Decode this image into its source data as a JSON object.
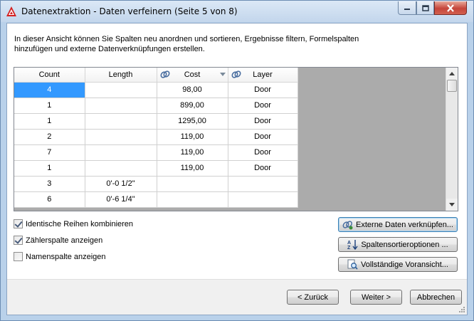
{
  "window": {
    "title": "Datenextraktion - Daten verfeinern (Seite 5 von 8)"
  },
  "description": "In dieser Ansicht können Sie Spalten neu anordnen und sortieren, Ergebnisse filtern, Formelspalten hinzufügen und externe Datenverknüpfungen erstellen.",
  "grid": {
    "columns": [
      "Count",
      "Length",
      "Cost",
      "Layer"
    ],
    "rows": [
      [
        "4",
        "",
        "98,00",
        "Door"
      ],
      [
        "1",
        "",
        "899,00",
        "Door"
      ],
      [
        "1",
        "",
        "1295,00",
        "Door"
      ],
      [
        "2",
        "",
        "119,00",
        "Door"
      ],
      [
        "7",
        "",
        "119,00",
        "Door"
      ],
      [
        "1",
        "",
        "119,00",
        "Door"
      ],
      [
        "3",
        "0'-0 1/2\"",
        "",
        ""
      ],
      [
        "6",
        "0'-6 1/4\"",
        "",
        ""
      ]
    ]
  },
  "options": {
    "combine_rows": {
      "label": "Identische Reihen kombinieren",
      "checked": true
    },
    "count_column": {
      "label": "Zählerspalte anzeigen",
      "checked": true
    },
    "name_column": {
      "label": "Namenspalte anzeigen",
      "checked": false
    }
  },
  "side_buttons": {
    "link_external": "Externe Daten verknüpfen...",
    "sort_options": "Spaltensortieroptionen ...",
    "full_preview": "Vollständige Voransicht..."
  },
  "footer": {
    "back": "< Zurück",
    "next": "Weiter >",
    "cancel": "Abbrechen"
  },
  "colors": {
    "selection": "#3399ff",
    "title_bar": "#c3d6ec",
    "close_button": "#c5453a"
  }
}
